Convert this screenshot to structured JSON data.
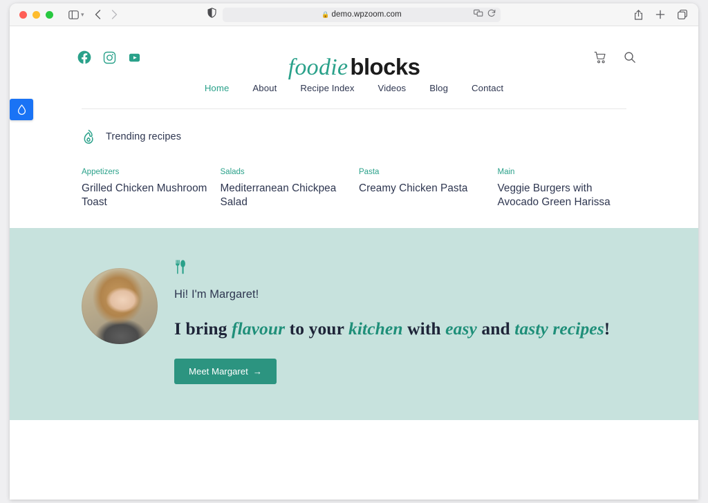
{
  "browser": {
    "url": "demo.wpzoom.com",
    "lock_icon": "lock-icon",
    "shield_icon": "shield-icon",
    "sidebar_icon": "sidebar-icon",
    "back_icon": "chevron-left-icon",
    "forward_icon": "chevron-right-icon",
    "extensions_icon": "extensions-icon",
    "reload_icon": "reload-icon",
    "share_icon": "share-icon",
    "new_tab_icon": "plus-icon",
    "tab_overview_icon": "tab-overview-icon",
    "traffic_lights": [
      "close",
      "minimize",
      "zoom"
    ]
  },
  "widget": {
    "name": "water-drop-tab",
    "color": "#1a73f5"
  },
  "site": {
    "logo": {
      "primary": "foodie",
      "secondary": "blocks"
    },
    "social": [
      {
        "name": "facebook-icon",
        "label": "Facebook"
      },
      {
        "name": "instagram-icon",
        "label": "Instagram"
      },
      {
        "name": "youtube-icon",
        "label": "YouTube"
      }
    ],
    "actions": [
      {
        "name": "cart-icon",
        "label": "Cart"
      },
      {
        "name": "search-icon",
        "label": "Search"
      }
    ],
    "nav": [
      {
        "label": "Home",
        "active": true
      },
      {
        "label": "About",
        "active": false
      },
      {
        "label": "Recipe Index",
        "active": false
      },
      {
        "label": "Videos",
        "active": false
      },
      {
        "label": "Blog",
        "active": false
      },
      {
        "label": "Contact",
        "active": false
      }
    ]
  },
  "trending": {
    "icon": "flame-icon",
    "title": "Trending recipes",
    "cards": [
      {
        "category": "Appetizers",
        "title": "Grilled Chicken Mushroom Toast",
        "photo": "grilled-sandwich-on-white-plate"
      },
      {
        "category": "Salads",
        "title": "Mediterranean Chickpea Salad",
        "photo": "chickpea-salad-bowl-on-wood-table"
      },
      {
        "category": "Pasta",
        "title": "Creamy Chicken Pasta",
        "photo": "creamy-pasta-in-black-pan-on-teal-plate"
      },
      {
        "category": "Main",
        "title": "Veggie Burgers with Avocado Green Harissa",
        "photo": "veggie-burger-on-teal-plate"
      }
    ]
  },
  "intro": {
    "icon": "utensils-icon",
    "avatar": "margaret-portrait",
    "greeting": "Hi! I'm Margaret!",
    "headline_parts": [
      {
        "text": "I bring ",
        "accent": false
      },
      {
        "text": "flavour",
        "accent": true
      },
      {
        "text": " to your ",
        "accent": false
      },
      {
        "text": "kitchen",
        "accent": true
      },
      {
        "text": " with ",
        "accent": false
      },
      {
        "text": "easy",
        "accent": true
      },
      {
        "text": " and ",
        "accent": false
      },
      {
        "text": "tasty recipes",
        "accent": true
      },
      {
        "text": "!",
        "accent": false
      }
    ],
    "button_label": "Meet Margaret",
    "button_arrow": "→",
    "background": "#c7e2dd"
  },
  "colors": {
    "accent_teal": "#2aa18a",
    "button_teal": "#2c9480",
    "text_navy": "#2e3650",
    "band_mint": "#c7e2dd",
    "widget_blue": "#1a73f5"
  }
}
